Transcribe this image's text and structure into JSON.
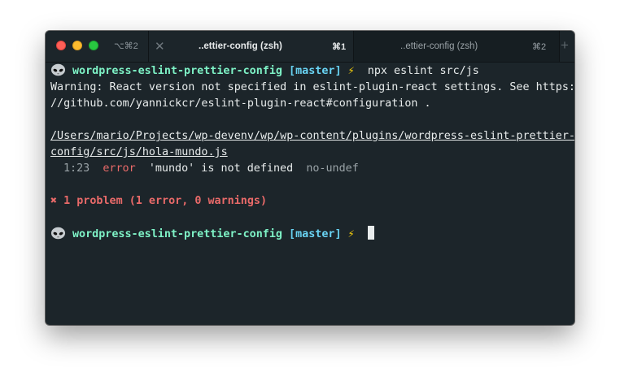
{
  "titlebar": {
    "window_shortcut": "⌥⌘2",
    "tabs": [
      {
        "title": "..ettier-config (zsh)",
        "shortcut": "⌘1",
        "active": true
      },
      {
        "title": "..ettier-config (zsh)",
        "shortcut": "⌘2",
        "active": false
      }
    ]
  },
  "terminal": {
    "prompt1": {
      "dir": "wordpress-eslint-prettier-config",
      "branch": "[master]",
      "symbol": "⚡",
      "command": "npx eslint src/js"
    },
    "warning_line1": "Warning: React version not specified in eslint-plugin-react settings. See https:",
    "warning_line2": "//github.com/yannickcr/eslint-plugin-react#configuration .",
    "file_line1": "/Users/mario/Projects/wp-devenv/wp/wp-content/plugins/wordpress-eslint-prettier-",
    "file_line2": "config/src/js/hola-mundo.js",
    "issue": {
      "location": "1:23",
      "severity": "error",
      "message": "'mundo' is not defined",
      "rule": "no-undef"
    },
    "summary": "✖ 1 problem (1 error, 0 warnings)",
    "prompt2": {
      "dir": "wordpress-eslint-prettier-config",
      "branch": "[master]",
      "symbol": "⚡"
    }
  },
  "colors": {
    "background": "#1c252a",
    "dir": "#7ef2c6",
    "branch": "#69d3f3",
    "error": "#e96a69",
    "bolt": "#ffd60a"
  }
}
